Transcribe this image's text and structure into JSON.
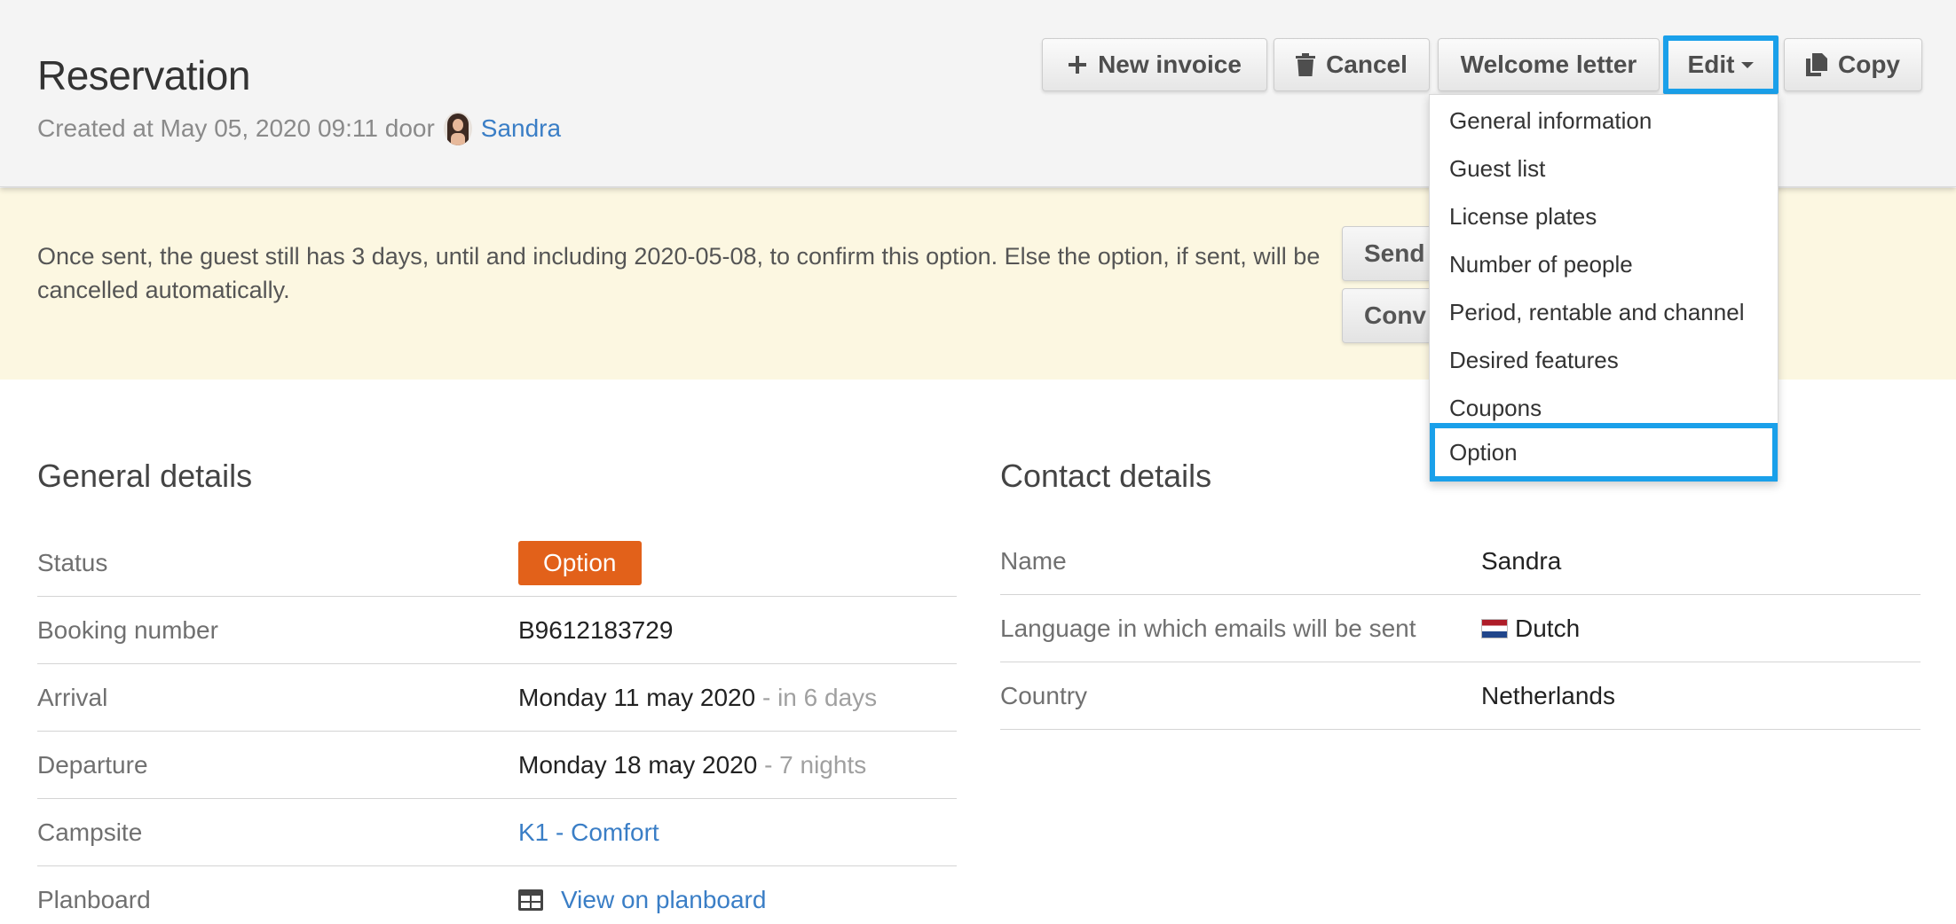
{
  "header": {
    "title": "Reservation",
    "created_prefix": "Created at May 05, 2020 09:11 door",
    "created_by": "Sandra"
  },
  "toolbar": {
    "new_invoice": "New invoice",
    "cancel": "Cancel",
    "welcome_letter": "Welcome letter",
    "edit": "Edit",
    "copy": "Copy"
  },
  "edit_menu": {
    "items": [
      "General information",
      "Guest list",
      "License plates",
      "Number of people",
      "Period, rentable and channel",
      "Desired features",
      "Coupons",
      "Option"
    ],
    "highlighted": "Option"
  },
  "notice": {
    "text": "Once sent, the guest still has 3 days, until and including 2020-05-08, to confirm this option. Else the option, if sent, will be cancelled automatically.",
    "send_label": "Send",
    "convert_label": "Conv"
  },
  "general": {
    "title": "General details",
    "status_label": "Status",
    "status_value": "Option",
    "booking_label": "Booking number",
    "booking_value": "B9612183729",
    "arrival_label": "Arrival",
    "arrival_value": "Monday 11 may 2020",
    "arrival_hint": "- in 6 days",
    "departure_label": "Departure",
    "departure_value": "Monday 18 may 2020",
    "departure_hint": "- 7 nights",
    "campsite_label": "Campsite",
    "campsite_value": "K1 - Comfort",
    "planboard_label": "Planboard",
    "planboard_value": "View on planboard"
  },
  "contact": {
    "title": "Contact details",
    "name_label": "Name",
    "name_value": "Sandra",
    "language_label": "Language in which emails will be sent",
    "language_value": "Dutch",
    "country_label": "Country",
    "country_value": "Netherlands"
  },
  "colors": {
    "accent": "#1aa0ea",
    "status_badge": "#e2611a",
    "link": "#3a7ec6",
    "notice_bg": "#fcf7e1"
  }
}
